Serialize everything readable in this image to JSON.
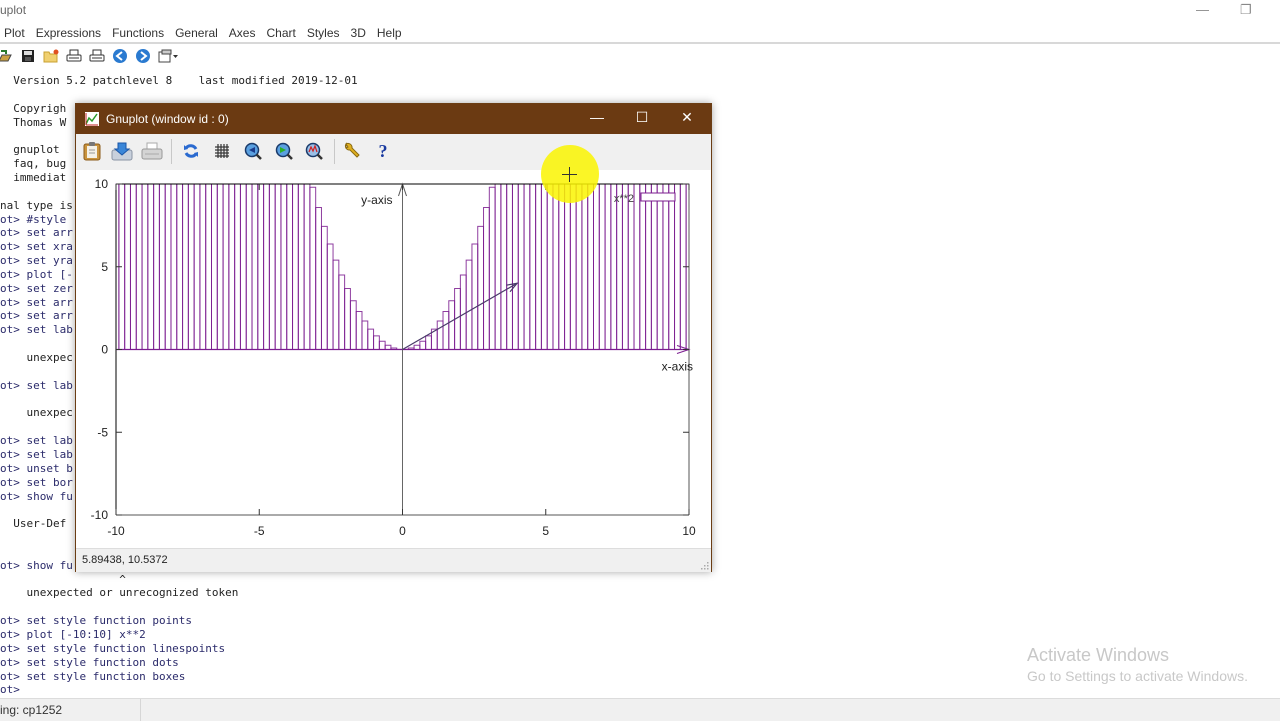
{
  "app": {
    "title": "Gnuplot",
    "title_visible": "uplot",
    "minimize_icon": "minimize-icon",
    "restore_icon": "restore-icon"
  },
  "menu": [
    "Plot",
    "Expressions",
    "Functions",
    "General",
    "Axes",
    "Chart",
    "Styles",
    "3D",
    "Help"
  ],
  "toolbar_icons": [
    "open-icon",
    "save-icon",
    "change-directory-icon",
    "print-icon",
    "print-setup-icon",
    "back-icon",
    "forward-icon",
    "options-dropdown-icon"
  ],
  "console": {
    "lines": [
      {
        "text": "  Version 5.2 patchlevel 8    last modified 2019-12-01",
        "cmd": false
      },
      {
        "text": "",
        "cmd": false
      },
      {
        "text": "  Copyrigh",
        "cmd": false
      },
      {
        "text": "  Thomas W",
        "cmd": false
      },
      {
        "text": "",
        "cmd": false
      },
      {
        "text": "  gnuplot ",
        "cmd": false
      },
      {
        "text": "  faq, bug",
        "cmd": false
      },
      {
        "text": "  immediat",
        "cmd": false
      },
      {
        "text": "",
        "cmd": false
      },
      {
        "text": "nal type is",
        "cmd": false
      },
      {
        "text": "ot> #style ",
        "cmd": true
      },
      {
        "text": "ot> set arr",
        "cmd": true
      },
      {
        "text": "ot> set xra",
        "cmd": true
      },
      {
        "text": "ot> set yra",
        "cmd": true
      },
      {
        "text": "ot> plot [-",
        "cmd": true
      },
      {
        "text": "ot> set zer",
        "cmd": true
      },
      {
        "text": "ot> set arr",
        "cmd": true
      },
      {
        "text": "ot> set arr",
        "cmd": true
      },
      {
        "text": "ot> set lab",
        "cmd": true
      },
      {
        "text": "",
        "cmd": false
      },
      {
        "text": "    unexpec",
        "cmd": false
      },
      {
        "text": "",
        "cmd": false
      },
      {
        "text": "ot> set lab",
        "cmd": true
      },
      {
        "text": "",
        "cmd": false
      },
      {
        "text": "    unexpec",
        "cmd": false
      },
      {
        "text": "",
        "cmd": false
      },
      {
        "text": "ot> set lab",
        "cmd": true
      },
      {
        "text": "ot> set lab",
        "cmd": true
      },
      {
        "text": "ot> unset b",
        "cmd": true
      },
      {
        "text": "ot> set bor",
        "cmd": true
      },
      {
        "text": "ot> show fu",
        "cmd": true
      },
      {
        "text": "",
        "cmd": false
      },
      {
        "text": "  User-Def",
        "cmd": false
      },
      {
        "text": "",
        "cmd": false
      },
      {
        "text": "",
        "cmd": false
      },
      {
        "text": "ot> show fu",
        "cmd": true
      },
      {
        "text": "                  ^",
        "cmd": false
      },
      {
        "text": "    unexpected or unrecognized token",
        "cmd": false
      },
      {
        "text": "",
        "cmd": false
      },
      {
        "text": "ot> set style function points",
        "cmd": true
      },
      {
        "text": "ot> plot [-10:10] x**2",
        "cmd": true
      },
      {
        "text": "ot> set style function linespoints",
        "cmd": true
      },
      {
        "text": "ot> set style function dots",
        "cmd": true
      },
      {
        "text": "ot> set style function boxes",
        "cmd": true
      },
      {
        "text": "ot>",
        "cmd": true
      }
    ]
  },
  "statusbar": {
    "encoding": "ing: cp1252"
  },
  "watermark": {
    "line1": "Activate Windows",
    "line2": "Go to Settings to activate Windows."
  },
  "gnuplot_window": {
    "title": "Gnuplot (window id : 0)",
    "controls": {
      "minimize": "—",
      "maximize": "☐",
      "close": "✕"
    },
    "toolbar_icons": [
      "copy-clipboard-icon",
      "export-icon",
      "print-icon",
      "replot-icon",
      "grid-icon",
      "zoom-previous-icon",
      "zoom-next-icon",
      "unzoom-icon",
      "options-icon",
      "help-icon"
    ],
    "status_coords": "5.89438,  10.5372"
  },
  "chart_data": {
    "type": "bar",
    "style": "boxes",
    "function": "x**2",
    "samples": 100,
    "xlim": [
      -10,
      10
    ],
    "ylim": [
      -10,
      10
    ],
    "xticks": [
      -10,
      -5,
      0,
      5,
      10
    ],
    "yticks": [
      -10,
      -5,
      0,
      5,
      10
    ],
    "xlabel": "x-axis",
    "ylabel": "y-axis",
    "legend": {
      "label": "x**2",
      "position": "top-right"
    },
    "series_color": "#7b1c8f",
    "arrow": {
      "from": [
        0,
        0
      ],
      "to": [
        4,
        4
      ]
    },
    "zeroaxis": true,
    "grid": false
  }
}
